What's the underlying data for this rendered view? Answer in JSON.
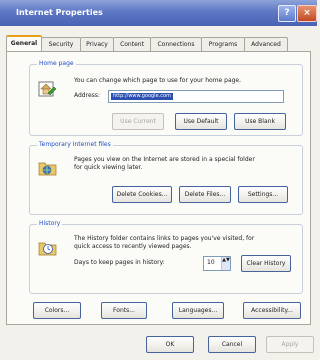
{
  "window": {
    "title": "Internet Properties",
    "help_label": "?",
    "close_label": "×"
  },
  "tabs": [
    {
      "label": "General",
      "active": true
    },
    {
      "label": "Security"
    },
    {
      "label": "Privacy"
    },
    {
      "label": "Content"
    },
    {
      "label": "Connections"
    },
    {
      "label": "Programs"
    },
    {
      "label": "Advanced"
    }
  ],
  "home_page": {
    "group_label": "Home page",
    "description": "You can change which page to use for your home page.",
    "address_label": "Address:",
    "address_value": "http://www.google.com",
    "use_current_label": "Use Current",
    "use_default_label": "Use Default",
    "use_blank_label": "Use Blank"
  },
  "temp_files": {
    "group_label": "Temporary Internet files",
    "description_line1": "Pages you view on the Internet are stored in a special folder",
    "description_line2": "for quick viewing later.",
    "delete_cookies_label": "Delete Cookies...",
    "delete_files_label": "Delete Files...",
    "settings_label": "Settings..."
  },
  "history": {
    "group_label": "History",
    "description_line1": "The History folder contains links to pages you've visited, for",
    "description_line2": "quick access to recently viewed pages.",
    "days_label": "Days to keep pages in history:",
    "days_value": "10",
    "spinner_arrows": "▲▼",
    "clear_history_label": "Clear History"
  },
  "bottom_row": {
    "colors_label": "Colors...",
    "fonts_label": "Fonts...",
    "languages_label": "Languages...",
    "accessibility_label": "Accessibility..."
  },
  "dialog_buttons": {
    "ok_label": "OK",
    "cancel_label": "Cancel",
    "apply_label": "Apply"
  },
  "colors": {
    "titlebar": "#4a62b4",
    "active_tab_accent": "#e6a01a",
    "group_label": "#1f4ec8"
  }
}
